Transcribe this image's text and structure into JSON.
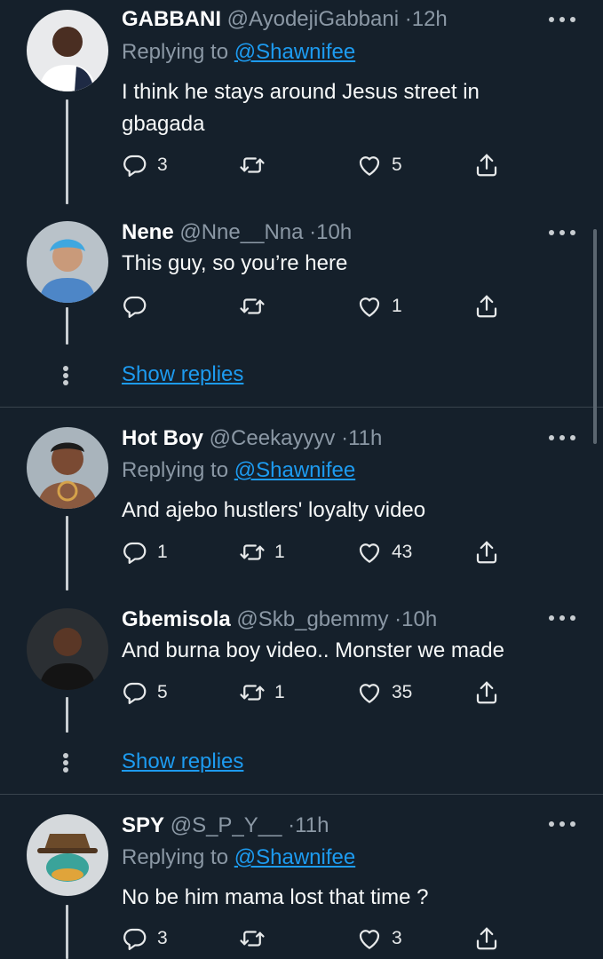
{
  "tweets": [
    {
      "name": "GABBANI",
      "handle": "@AyodejiGabbani",
      "dot": "·",
      "time": "12h",
      "replying_prefix": "Replying to",
      "replying_to": "@Shawnifee",
      "text": "I think he stays around Jesus street in gbagada",
      "replies": "3",
      "retweets": "",
      "likes": "5"
    },
    {
      "name": "Nene",
      "handle": "@Nne__Nna",
      "dot": "·",
      "time": "10h",
      "text": "This guy, so you’re here",
      "replies": "",
      "retweets": "",
      "likes": "1",
      "show_replies": "Show replies"
    },
    {
      "name": "Hot Boy",
      "handle": "@Ceekayyyv",
      "dot": "·",
      "time": "11h",
      "replying_prefix": "Replying to",
      "replying_to": "@Shawnifee",
      "text": "And ajebo hustlers' loyalty video",
      "replies": "1",
      "retweets": "1",
      "likes": "43"
    },
    {
      "name": "Gbemisola",
      "handle": "@Skb_gbemmy",
      "dot": "·",
      "time": "10h",
      "text": "And burna boy video.. Monster we made",
      "replies": "5",
      "retweets": "1",
      "likes": "35",
      "show_replies": "Show replies"
    },
    {
      "name": "SPY",
      "handle": "@S_P_Y__",
      "dot": "·",
      "time": "11h",
      "replying_prefix": "Replying to",
      "replying_to": "@Shawnifee",
      "text": "No be him mama lost that time ?",
      "replies": "3",
      "retweets": "",
      "likes": "3"
    }
  ],
  "icons": {
    "reply": "reply-icon",
    "retweet": "retweet-icon",
    "like": "heart-icon",
    "share": "share-icon",
    "more": "more-options-icon"
  },
  "colors": {
    "background": "#15202b",
    "link": "#1d9bf0",
    "muted": "#8b98a5",
    "divider": "#38444d"
  }
}
